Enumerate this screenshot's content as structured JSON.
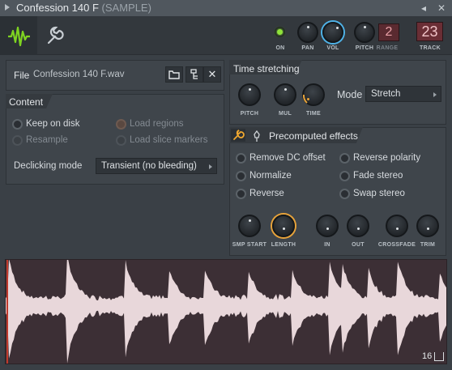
{
  "title": {
    "main": "Confession 140 F",
    "sub": "(SAMPLE)"
  },
  "toolbar": {
    "on_label": "ON",
    "pan_label": "PAN",
    "vol_label": "VOL",
    "pitch_label": "PITCH",
    "range_label": "RANGE",
    "range_value": "2",
    "track_label": "TRACK",
    "track_value": "23",
    "on_color": "#7ed321",
    "accent_red": "#e25454"
  },
  "file": {
    "label": "File",
    "name": "Confession 140 F.wav"
  },
  "content": {
    "header": "Content",
    "keep_on_disk": "Keep on disk",
    "resample": "Resample",
    "load_regions": "Load regions",
    "load_slice_markers": "Load slice markers",
    "declicking_label": "Declicking mode",
    "declicking_value": "Transient (no bleeding)"
  },
  "time_stretching": {
    "header": "Time stretching",
    "pitch": "PITCH",
    "mul": "MUL",
    "time": "TIME",
    "mode_label": "Mode",
    "mode_value": "Stretch"
  },
  "precomputed": {
    "header": "Precomputed effects",
    "remove_dc": "Remove DC offset",
    "normalize": "Normalize",
    "reverse": "Reverse",
    "reverse_polarity": "Reverse polarity",
    "fade_stereo": "Fade stereo",
    "swap_stereo": "Swap stereo",
    "knobs": [
      "SMP START",
      "LENGTH",
      "IN",
      "OUT",
      "CROSSFADE",
      "TRIM"
    ]
  },
  "waveform": {
    "zoom_value": "16",
    "wave_color": "#e8d7da",
    "marker_color": "#c0392b"
  }
}
